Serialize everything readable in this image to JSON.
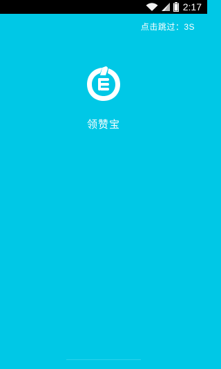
{
  "status_bar": {
    "time": "2:17",
    "icons": [
      "wifi-icon",
      "signal-icon",
      "battery-icon"
    ]
  },
  "splash": {
    "skip_label": "点击跳过：3S",
    "app_name": "领赞宝",
    "logo_icon": "thumb-up-list-logo-icon"
  },
  "colors": {
    "background": "#00c8e6",
    "status_bar": "#000000",
    "text": "#ffffff"
  }
}
